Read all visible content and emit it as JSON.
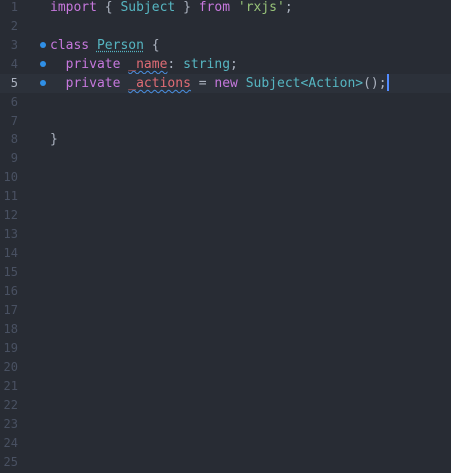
{
  "gutter": {
    "line_numbers": [
      "1",
      "2",
      "3",
      "4",
      "5",
      "6",
      "7",
      "8",
      "9",
      "10",
      "11",
      "12",
      "13",
      "14",
      "15",
      "16",
      "17",
      "18",
      "19",
      "20",
      "21",
      "22",
      "23",
      "24",
      "25"
    ]
  },
  "code": {
    "line1": {
      "import_kw": "import",
      "brace_open": " { ",
      "subject": "Subject",
      "brace_close": " } ",
      "from_kw": "from",
      "space": " ",
      "module": "'rxjs'",
      "semi": ";"
    },
    "line3": {
      "class_kw": "class",
      "space": " ",
      "class_name": "Person",
      "brace": " {"
    },
    "line4": {
      "indent": "  ",
      "private_kw": "private",
      "space": " ",
      "field": "_name",
      "colon": ": ",
      "type": "string",
      "semi": ";"
    },
    "line5": {
      "indent": "  ",
      "private_kw": "private",
      "space": " ",
      "field": "_actions",
      "eq": " = ",
      "new_kw": "new",
      "space2": " ",
      "generic": "Subject<Action>",
      "call": "();"
    },
    "line8": {
      "brace": "}"
    }
  },
  "colors": {
    "background": "#282c34",
    "keyword": "#c678dd",
    "class": "#e5c07b",
    "string": "#98c379",
    "field": "#e06c75",
    "type": "#56b6c2",
    "gutter": "#495162",
    "breakpoint": "#2f8fe6",
    "cursor": "#528bff"
  },
  "cursor_position": {
    "line": 5
  }
}
